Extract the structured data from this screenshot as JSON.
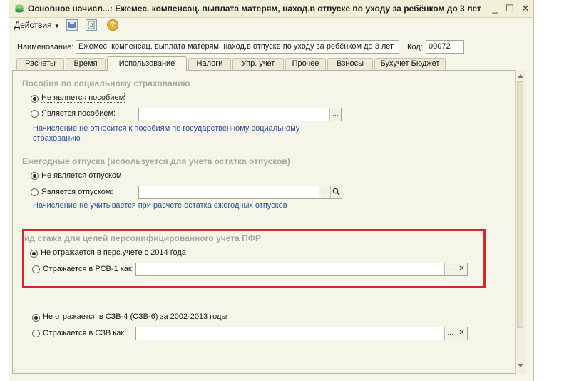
{
  "window": {
    "title": "Основное начисл...: Ежемес. компенсац. выплата матерям, наход.в отпуске по уходу за ребёнком до 3 лет",
    "min_label": "_",
    "max_label": "☐",
    "close_label": "✕"
  },
  "toolbar": {
    "actions_label": "Действия",
    "help_label": "?"
  },
  "form": {
    "name_label": "Наименование:",
    "name_value": "Ежемес. компенсац. выплата матерям, наход.в отпуске по уходу за ребёнком до 3 лет",
    "code_label": "Код:",
    "code_value": "00072"
  },
  "tabs": [
    "Расчеты",
    "Время",
    "Использование",
    "Налоги",
    "Упр. учет",
    "Прочее",
    "Взносы",
    "Бухучет Бюджет"
  ],
  "active_tab": "Использование",
  "benefits": {
    "header": "Пособия по социальному страхованию",
    "opt1": "Не является пособием",
    "opt2": "Является пособием:",
    "note": "Начисление не относится к пособиям по государственному социальному страхованию",
    "select_btn": "..."
  },
  "vacation": {
    "header": "Ежегодные отпуска (используется для учета остатка отпусков)",
    "opt1": "Не является отпуском",
    "opt2": "Является отпуском:",
    "note": "Начисление не учитывается при расчете остатка ежегодных отпусков",
    "select_btn": "..."
  },
  "pfr": {
    "header": "ид стажа для целей персонифицированного учета ПФР",
    "opt1": "Не отражается в перс.учете с 2014 года",
    "opt2": "Отражается в РСВ-1 как:",
    "select_btn": "...",
    "clear_btn": "✕"
  },
  "szv": {
    "opt1": "Не отражается в СЗВ-4 (СЗВ-6) за 2002-2013 годы",
    "opt2": "Отражается в СЗВ как:",
    "select_btn": "...",
    "clear_btn": "✕"
  },
  "colors": {
    "highlight_box": "#d4262c",
    "note_text": "#2c4f9e",
    "section_header": "#a9a99b",
    "window_bg": "#f6f5ea"
  }
}
